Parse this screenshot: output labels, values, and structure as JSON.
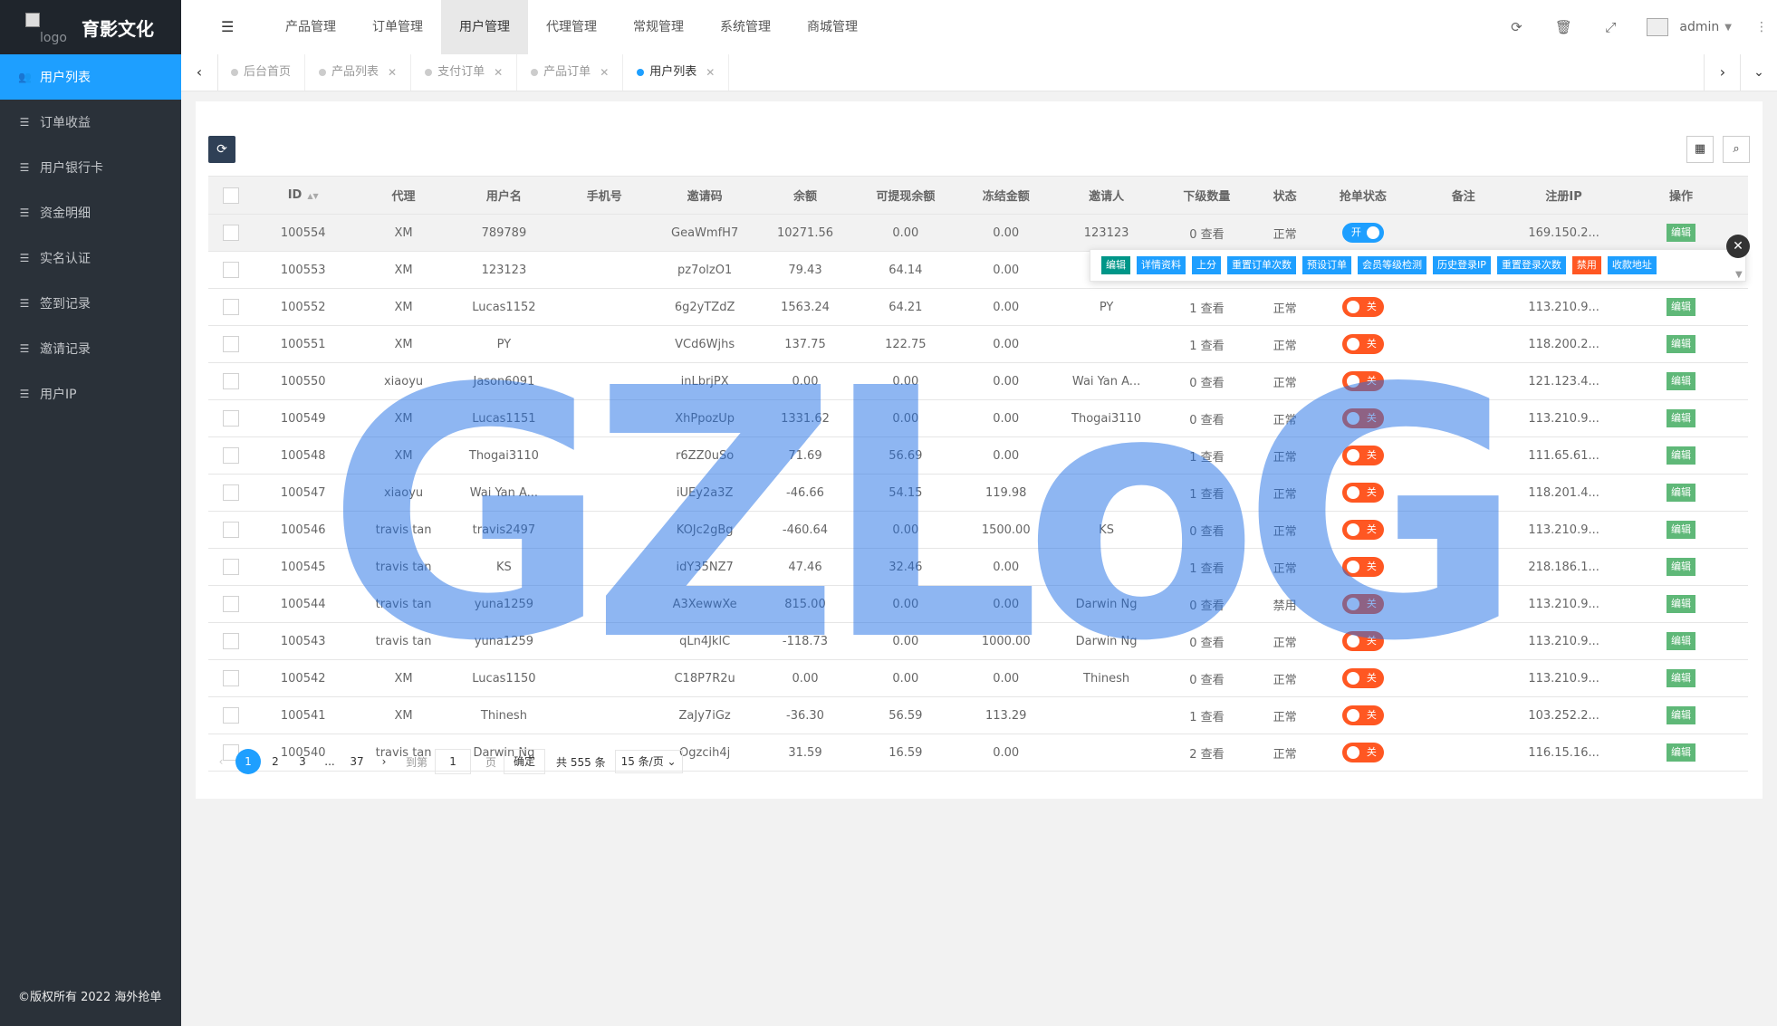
{
  "sidebar": {
    "logo_alt": "logo",
    "title": "育影文化",
    "items": [
      {
        "label": "用户列表",
        "icon": "users-icon",
        "active": true
      },
      {
        "label": "订单收益",
        "icon": "list-icon"
      },
      {
        "label": "用户银行卡",
        "icon": "list-icon"
      },
      {
        "label": "资金明细",
        "icon": "list-icon"
      },
      {
        "label": "实名认证",
        "icon": "list-icon"
      },
      {
        "label": "签到记录",
        "icon": "list-icon"
      },
      {
        "label": "邀请记录",
        "icon": "list-icon"
      },
      {
        "label": "用户IP",
        "icon": "list-icon"
      }
    ],
    "copyright": "©版权所有 2022 海外抢单"
  },
  "header": {
    "nav": [
      "产品管理",
      "订单管理",
      "用户管理",
      "代理管理",
      "常规管理",
      "系统管理",
      "商城管理"
    ],
    "active_nav": "用户管理",
    "user": "admin"
  },
  "tabs": [
    {
      "label": "后台首页",
      "closable": false
    },
    {
      "label": "产品列表",
      "closable": true
    },
    {
      "label": "支付订单",
      "closable": true
    },
    {
      "label": "产品订单",
      "closable": true
    },
    {
      "label": "用户列表",
      "closable": true,
      "active": true
    }
  ],
  "table": {
    "columns": [
      "ID",
      "代理",
      "用户名",
      "手机号",
      "邀请码",
      "余额",
      "可提现余额",
      "冻结金额",
      "邀请人",
      "下级数量",
      "状态",
      "抢单状态",
      "备注",
      "注册IP",
      "操作"
    ],
    "rows": [
      {
        "id": "100554",
        "agent": "XM",
        "username": "789789",
        "phone": "",
        "code": "GeaWmfH7",
        "balance": "10271.56",
        "withdrawable": "0.00",
        "frozen": "0.00",
        "inviter": "123123",
        "subs": "0 查看",
        "status": "正常",
        "grab": "开",
        "remark": "",
        "ip": "169.150.2...",
        "op": "编辑"
      },
      {
        "id": "100553",
        "agent": "XM",
        "username": "123123",
        "phone": "",
        "code": "pz7olzO1",
        "balance": "79.43",
        "withdrawable": "64.14",
        "frozen": "0.00",
        "inviter": "L",
        "subs": "",
        "status": "",
        "grab": "",
        "remark": "",
        "ip": "",
        "op": ""
      },
      {
        "id": "100552",
        "agent": "XM",
        "username": "Lucas1152",
        "phone": "",
        "code": "6g2yTZdZ",
        "balance": "1563.24",
        "withdrawable": "64.21",
        "frozen": "0.00",
        "inviter": "PY",
        "subs": "1 查看",
        "status": "正常",
        "grab": "关",
        "remark": "",
        "ip": "113.210.9...",
        "op": "编辑"
      },
      {
        "id": "100551",
        "agent": "XM",
        "username": "PY",
        "phone": "",
        "code": "VCd6Wjhs",
        "balance": "137.75",
        "withdrawable": "122.75",
        "frozen": "0.00",
        "inviter": "",
        "subs": "1 查看",
        "status": "正常",
        "grab": "关",
        "remark": "",
        "ip": "118.200.2...",
        "op": "编辑"
      },
      {
        "id": "100550",
        "agent": "xiaoyu",
        "username": "Jason6091",
        "phone": "",
        "code": "inLbrjPX",
        "balance": "0.00",
        "withdrawable": "0.00",
        "frozen": "0.00",
        "inviter": "Wai Yan A...",
        "subs": "0 查看",
        "status": "正常",
        "grab": "关",
        "remark": "",
        "ip": "121.123.4...",
        "op": "编辑"
      },
      {
        "id": "100549",
        "agent": "XM",
        "username": "Lucas1151",
        "phone": "",
        "code": "XhPpozUp",
        "balance": "1331.62",
        "withdrawable": "0.00",
        "frozen": "0.00",
        "inviter": "Thogai3110",
        "subs": "0 查看",
        "status": "正常",
        "grab": "关",
        "remark": "",
        "ip": "113.210.9...",
        "op": "编辑"
      },
      {
        "id": "100548",
        "agent": "XM",
        "username": "Thogai3110",
        "phone": "",
        "code": "r6ZZ0uSo",
        "balance": "71.69",
        "withdrawable": "56.69",
        "frozen": "0.00",
        "inviter": "",
        "subs": "1 查看",
        "status": "正常",
        "grab": "关",
        "remark": "",
        "ip": "111.65.61...",
        "op": "编辑"
      },
      {
        "id": "100547",
        "agent": "xiaoyu",
        "username": "Wai Yan A...",
        "phone": "",
        "code": "iUEy2a3Z",
        "balance": "-46.66",
        "withdrawable": "54.15",
        "frozen": "119.98",
        "inviter": "",
        "subs": "1 查看",
        "status": "正常",
        "grab": "关",
        "remark": "",
        "ip": "118.201.4...",
        "op": "编辑"
      },
      {
        "id": "100546",
        "agent": "travis tan",
        "username": "travis2497",
        "phone": "",
        "code": "KOJc2gBg",
        "balance": "-460.64",
        "withdrawable": "0.00",
        "frozen": "1500.00",
        "inviter": "KS",
        "subs": "0 查看",
        "status": "正常",
        "grab": "关",
        "remark": "",
        "ip": "113.210.9...",
        "op": "编辑"
      },
      {
        "id": "100545",
        "agent": "travis tan",
        "username": "KS",
        "phone": "",
        "code": "idY35NZ7",
        "balance": "47.46",
        "withdrawable": "32.46",
        "frozen": "0.00",
        "inviter": "",
        "subs": "1 查看",
        "status": "正常",
        "grab": "关",
        "remark": "",
        "ip": "218.186.1...",
        "op": "编辑"
      },
      {
        "id": "100544",
        "agent": "travis tan",
        "username": "yuna1259",
        "phone": "",
        "code": "A3XewwXe",
        "balance": "815.00",
        "withdrawable": "0.00",
        "frozen": "0.00",
        "inviter": "Darwin Ng",
        "subs": "0 查看",
        "status": "禁用",
        "grab": "关",
        "remark": "",
        "ip": "113.210.9...",
        "op": "编辑"
      },
      {
        "id": "100543",
        "agent": "travis tan",
        "username": "yuna1259",
        "phone": "",
        "code": "qLn4JklC",
        "balance": "-118.73",
        "withdrawable": "0.00",
        "frozen": "1000.00",
        "inviter": "Darwin Ng",
        "subs": "0 查看",
        "status": "正常",
        "grab": "关",
        "remark": "",
        "ip": "113.210.9...",
        "op": "编辑"
      },
      {
        "id": "100542",
        "agent": "XM",
        "username": "Lucas1150",
        "phone": "",
        "code": "C18P7R2u",
        "balance": "0.00",
        "withdrawable": "0.00",
        "frozen": "0.00",
        "inviter": "Thinesh",
        "subs": "0 查看",
        "status": "正常",
        "grab": "关",
        "remark": "",
        "ip": "113.210.9...",
        "op": "编辑"
      },
      {
        "id": "100541",
        "agent": "XM",
        "username": "Thinesh",
        "phone": "",
        "code": "ZaJy7iGz",
        "balance": "-36.30",
        "withdrawable": "56.59",
        "frozen": "113.29",
        "inviter": "",
        "subs": "1 查看",
        "status": "正常",
        "grab": "关",
        "remark": "",
        "ip": "103.252.2...",
        "op": "编辑"
      },
      {
        "id": "100540",
        "agent": "travis tan",
        "username": "Darwin Ng",
        "phone": "",
        "code": "Ogzcih4j",
        "balance": "31.59",
        "withdrawable": "16.59",
        "frozen": "0.00",
        "inviter": "",
        "subs": "2 查看",
        "status": "正常",
        "grab": "关",
        "remark": "",
        "ip": "116.15.16...",
        "op": "编辑"
      }
    ]
  },
  "row_actions": [
    {
      "label": "编辑",
      "style": "teal"
    },
    {
      "label": "详情资料",
      "style": "primary"
    },
    {
      "label": "上分",
      "style": "primary"
    },
    {
      "label": "重置订单次数",
      "style": "primary"
    },
    {
      "label": "预设订单",
      "style": "primary"
    },
    {
      "label": "会员等级检测",
      "style": "primary"
    },
    {
      "label": "历史登录IP",
      "style": "primary"
    },
    {
      "label": "重置登录次数",
      "style": "primary"
    },
    {
      "label": "禁用",
      "style": "danger"
    },
    {
      "label": "收款地址",
      "style": "primary"
    }
  ],
  "pagination": {
    "pages": [
      "1",
      "2",
      "3",
      "...",
      "37"
    ],
    "current": "1",
    "goto_label": "到第",
    "goto_value": "1",
    "page_label": "页",
    "confirm": "确定",
    "total": "共 555 条",
    "per_page": "15 条/页"
  },
  "watermark": "GZLoG",
  "colors": {
    "primary": "#1e9fff",
    "sidebar": "#2a3139",
    "danger": "#ff5722",
    "success": "#5fb878",
    "teal": "#009688"
  }
}
